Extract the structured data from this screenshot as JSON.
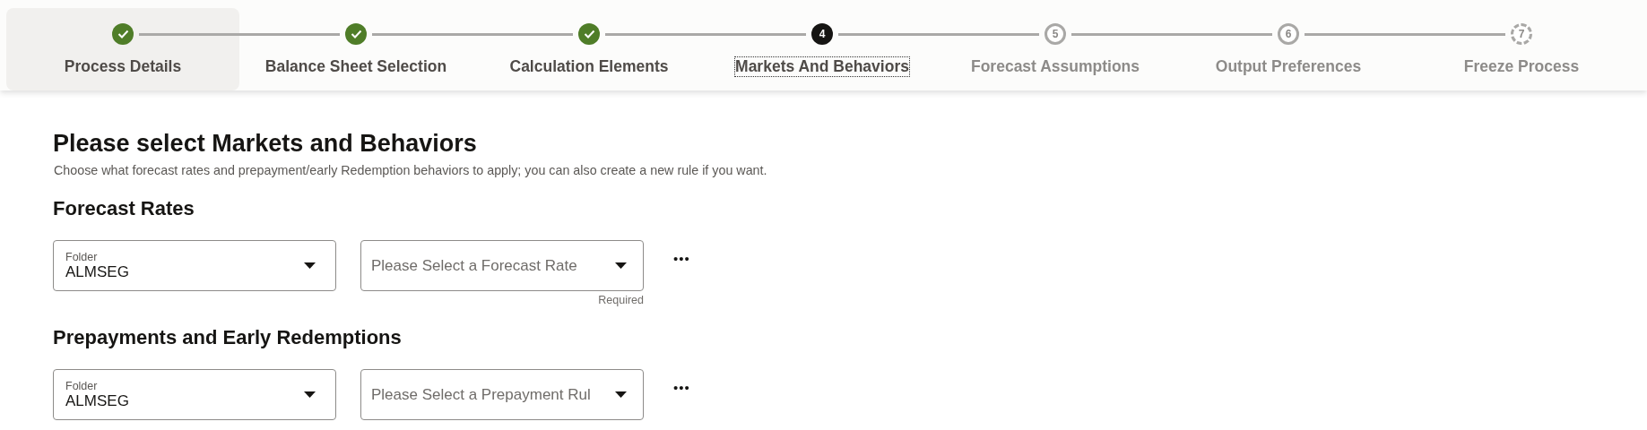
{
  "steps": [
    {
      "label": "Process Details",
      "kind": "done",
      "highlighted": true
    },
    {
      "label": "Balance Sheet Selection",
      "kind": "done",
      "highlighted": false
    },
    {
      "label": "Calculation Elements",
      "kind": "done",
      "highlighted": false
    },
    {
      "label": "Markets And Behaviors",
      "number": "4",
      "kind": "current",
      "highlighted": false
    },
    {
      "label": "Forecast Assumptions",
      "number": "5",
      "kind": "pending",
      "highlighted": false
    },
    {
      "label": "Output Preferences",
      "number": "6",
      "kind": "pending",
      "highlighted": false
    },
    {
      "label": "Freeze Process",
      "number": "7",
      "kind": "locked",
      "highlighted": false
    }
  ],
  "page": {
    "title": "Please select Markets and Behaviors",
    "description": "Choose what forecast rates and prepayment/early Redemption behaviors to apply; you can also create a new rule if you want."
  },
  "sections": [
    {
      "title": "Forecast Rates",
      "folder": {
        "label": "Folder",
        "value": "ALMSEG"
      },
      "rule": {
        "placeholder": "Please Select a Forecast Rate",
        "helper": "Required"
      },
      "more": "•••"
    },
    {
      "title": "Prepayments and Early Redemptions",
      "folder": {
        "label": "Folder",
        "value": "ALMSEG"
      },
      "rule": {
        "placeholder": "Please Select a Prepayment Rul"
      },
      "more": "•••"
    }
  ]
}
